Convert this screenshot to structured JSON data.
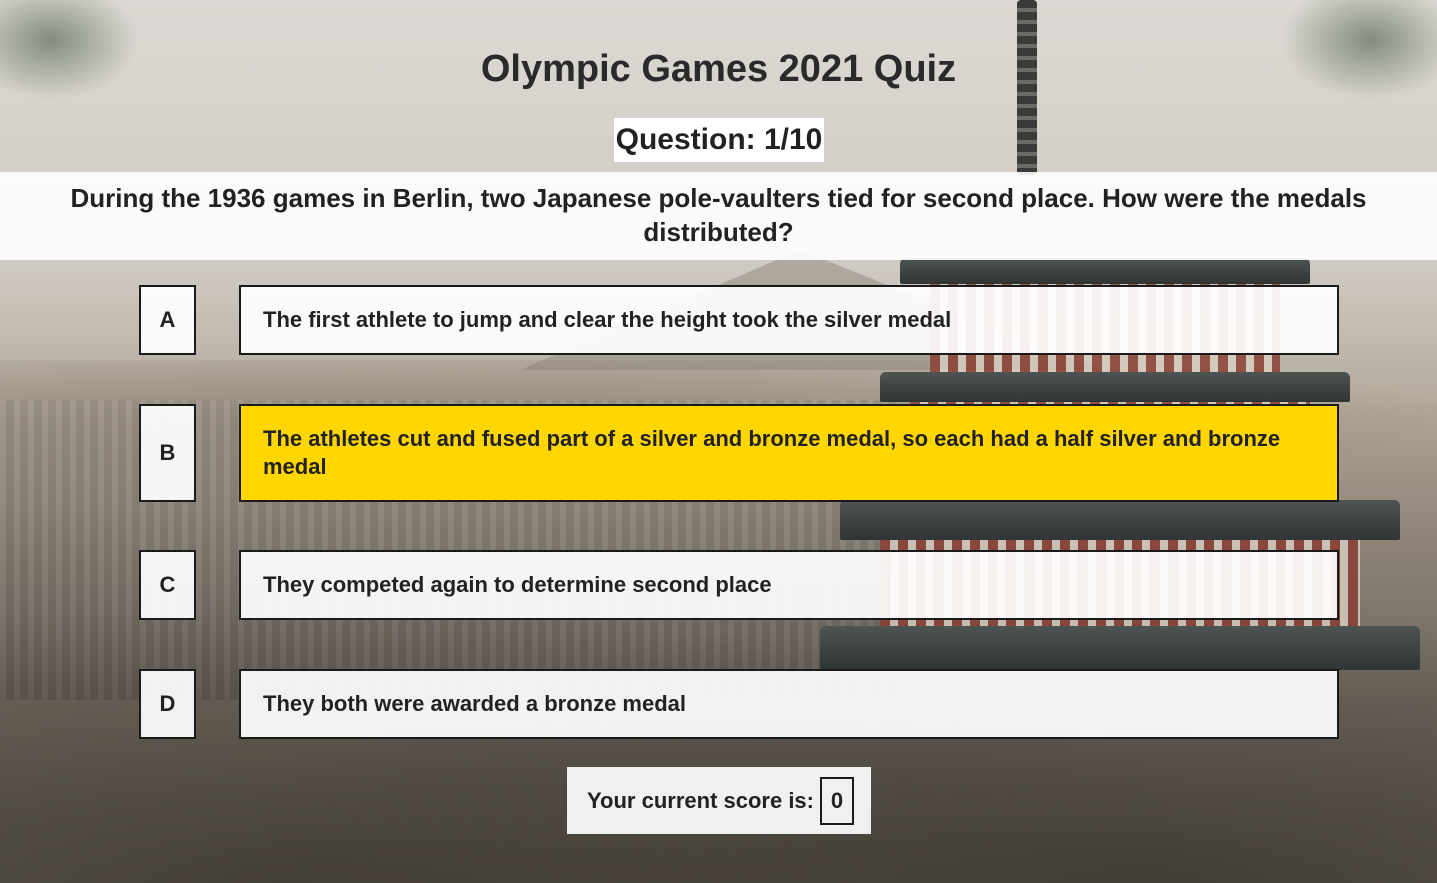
{
  "quiz": {
    "title": "Olympic Games 2021 Quiz",
    "counter": "Question: 1/10",
    "question": "During the 1936 games in Berlin, two Japanese pole-vaulters tied for second place. How were the medals distributed?",
    "answers": [
      {
        "letter": "A",
        "text": "The first athlete to jump and clear the height took the silver medal",
        "selected": false
      },
      {
        "letter": "B",
        "text": "The athletes cut and fused part of a silver and bronze medal, so each had a half silver and bronze medal",
        "selected": true
      },
      {
        "letter": "C",
        "text": "They competed again to determine second place",
        "selected": false
      },
      {
        "letter": "D",
        "text": "They both were awarded a bronze medal",
        "selected": false
      }
    ],
    "score_label": "Your current score is:",
    "score_value": "0"
  },
  "colors": {
    "selected_highlight": "#ffd600",
    "panel": "#ffffff",
    "border": "#1a1a1a"
  },
  "background": {
    "scene": "pagoda-and-city-photo"
  }
}
